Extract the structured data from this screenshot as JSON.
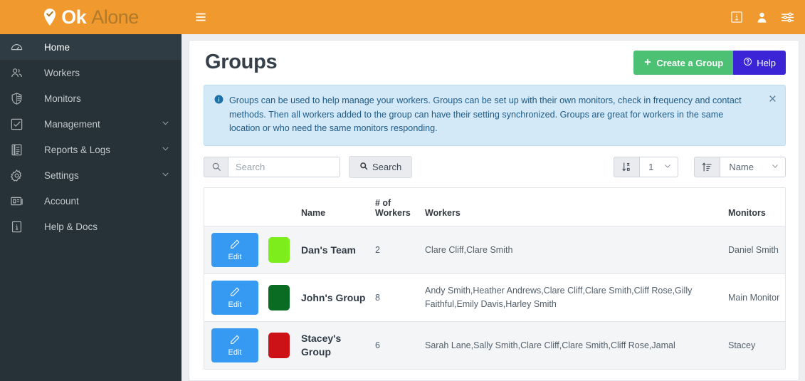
{
  "brand": {
    "name_bold": "Ok",
    "name_light": "Alone",
    "pin_icon": "location-pin-check-icon"
  },
  "sidebar": {
    "items": [
      {
        "label": "Home",
        "icon": "dashboard-icon",
        "active": true,
        "caret": false
      },
      {
        "label": "Workers",
        "icon": "users-icon",
        "active": false,
        "caret": false
      },
      {
        "label": "Monitors",
        "icon": "shield-icon",
        "active": false,
        "caret": false
      },
      {
        "label": "Management",
        "icon": "check-square-icon",
        "active": false,
        "caret": true
      },
      {
        "label": "Reports & Logs",
        "icon": "book-icon",
        "active": false,
        "caret": true
      },
      {
        "label": "Settings",
        "icon": "gear-icon",
        "active": false,
        "caret": true
      },
      {
        "label": "Account",
        "icon": "id-card-icon",
        "active": false,
        "caret": false
      },
      {
        "label": "Help & Docs",
        "icon": "info-box-icon",
        "active": false,
        "caret": false
      }
    ]
  },
  "topbar": {
    "menu_icon": "hamburger-menu-icon",
    "info_icon": "info-box-icon",
    "user_icon": "user-icon",
    "settings_icon": "sliders-icon"
  },
  "page": {
    "title": "Groups",
    "create_label": "Create a Group",
    "create_icon": "plus-icon",
    "help_label": "Help",
    "help_icon": "question-circle-icon"
  },
  "alert": {
    "icon": "info-circle-icon",
    "text": "Groups can be used to help manage your workers. Groups can be set up with their own monitors, check in frequency and contact methods. Then all workers added to the group can have their setting synchronized. Groups are great for workers in the same location or who need the same monitors responding.",
    "close_icon": "close-icon"
  },
  "toolbar": {
    "search_addon_icon": "search-icon",
    "search_value": "",
    "search_placeholder": "Search",
    "search_button_label": "Search",
    "search_button_icon": "search-icon",
    "page_size_icon": "sort-numeric-icon",
    "page_size_value": "1",
    "sort_icon": "sort-amount-icon",
    "sort_value": "Name",
    "caret_icon": "chevron-down-icon"
  },
  "table": {
    "headers": [
      "",
      "",
      "Name",
      "# of Workers",
      "Workers",
      "Monitors"
    ],
    "edit_label": "Edit",
    "edit_icon": "pencil-icon",
    "rows": [
      {
        "color": "#7ded1b",
        "name": "Dan's Team",
        "num_workers": "2",
        "workers": "Clare Cliff,Clare Smith",
        "monitors": "Daniel Smith"
      },
      {
        "color": "#0a6b23",
        "name": "John's Group",
        "num_workers": "8",
        "workers": "Andy Smith,Heather Andrews,Clare Cliff,Clare Smith,Cliff Rose,Gilly Faithful,Emily Davis,Harley Smith",
        "monitors": "Main Monitor"
      },
      {
        "color": "#cc1117",
        "name": "Stacey's Group",
        "num_workers": "6",
        "workers": "Sarah Lane,Sally Smith,Clare Cliff,Clare Smith,Cliff Rose,Jamal",
        "monitors": "Stacey"
      }
    ]
  },
  "colors": {
    "brand_orange": "#f0992e",
    "sidebar_dark": "#263238",
    "create_green": "#4cc073",
    "help_blue": "#3a24d6",
    "edit_blue": "#379af2",
    "alert_bg": "#d4e9f7"
  }
}
